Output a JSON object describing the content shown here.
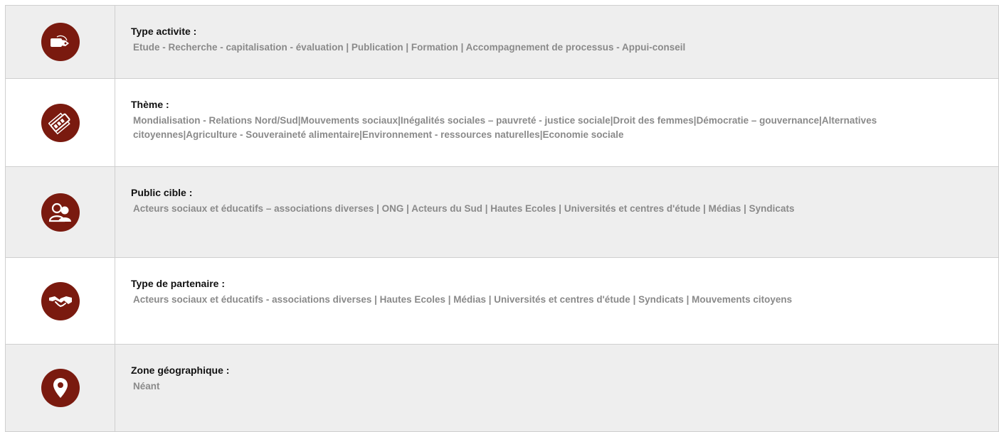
{
  "rows": [
    {
      "label": "Type activite :",
      "value": "Etude - Recherche - capitalisation - évaluation | Publication | Formation | Accompagnement de processus - Appui-conseil",
      "icon": "price-tag-icon"
    },
    {
      "label": "Thème :",
      "value": "Mondialisation - Relations Nord/Sud|Mouvements sociaux|Inégalités sociales – pauvreté - justice sociale|Droit des femmes|Démocratie – gouvernance|Alternatives citoyennes|Agriculture - Souveraineté alimentaire|Environnement - ressources naturelles|Economie sociale",
      "icon": "swatch-palette-icon"
    },
    {
      "label": "Public cible :",
      "value": "Acteurs sociaux et éducatifs – associations diverses | ONG | Acteurs du Sud | Hautes Ecoles | Universités et centres d'étude | Médias | Syndicats",
      "icon": "users-icon"
    },
    {
      "label": "Type de partenaire :",
      "value": "Acteurs sociaux et éducatifs - associations diverses | Hautes Ecoles | Médias | Universités et centres d'étude | Syndicats | Mouvements citoyens",
      "icon": "handshake-icon"
    },
    {
      "label": "Zone géographique :",
      "value": "Néant",
      "icon": "map-pin-icon"
    }
  ],
  "colors": {
    "icon_bg": "#7a1a0f",
    "alt_row_bg": "#eeeeee",
    "label_text": "#111111",
    "value_text": "#8a8a8a"
  }
}
